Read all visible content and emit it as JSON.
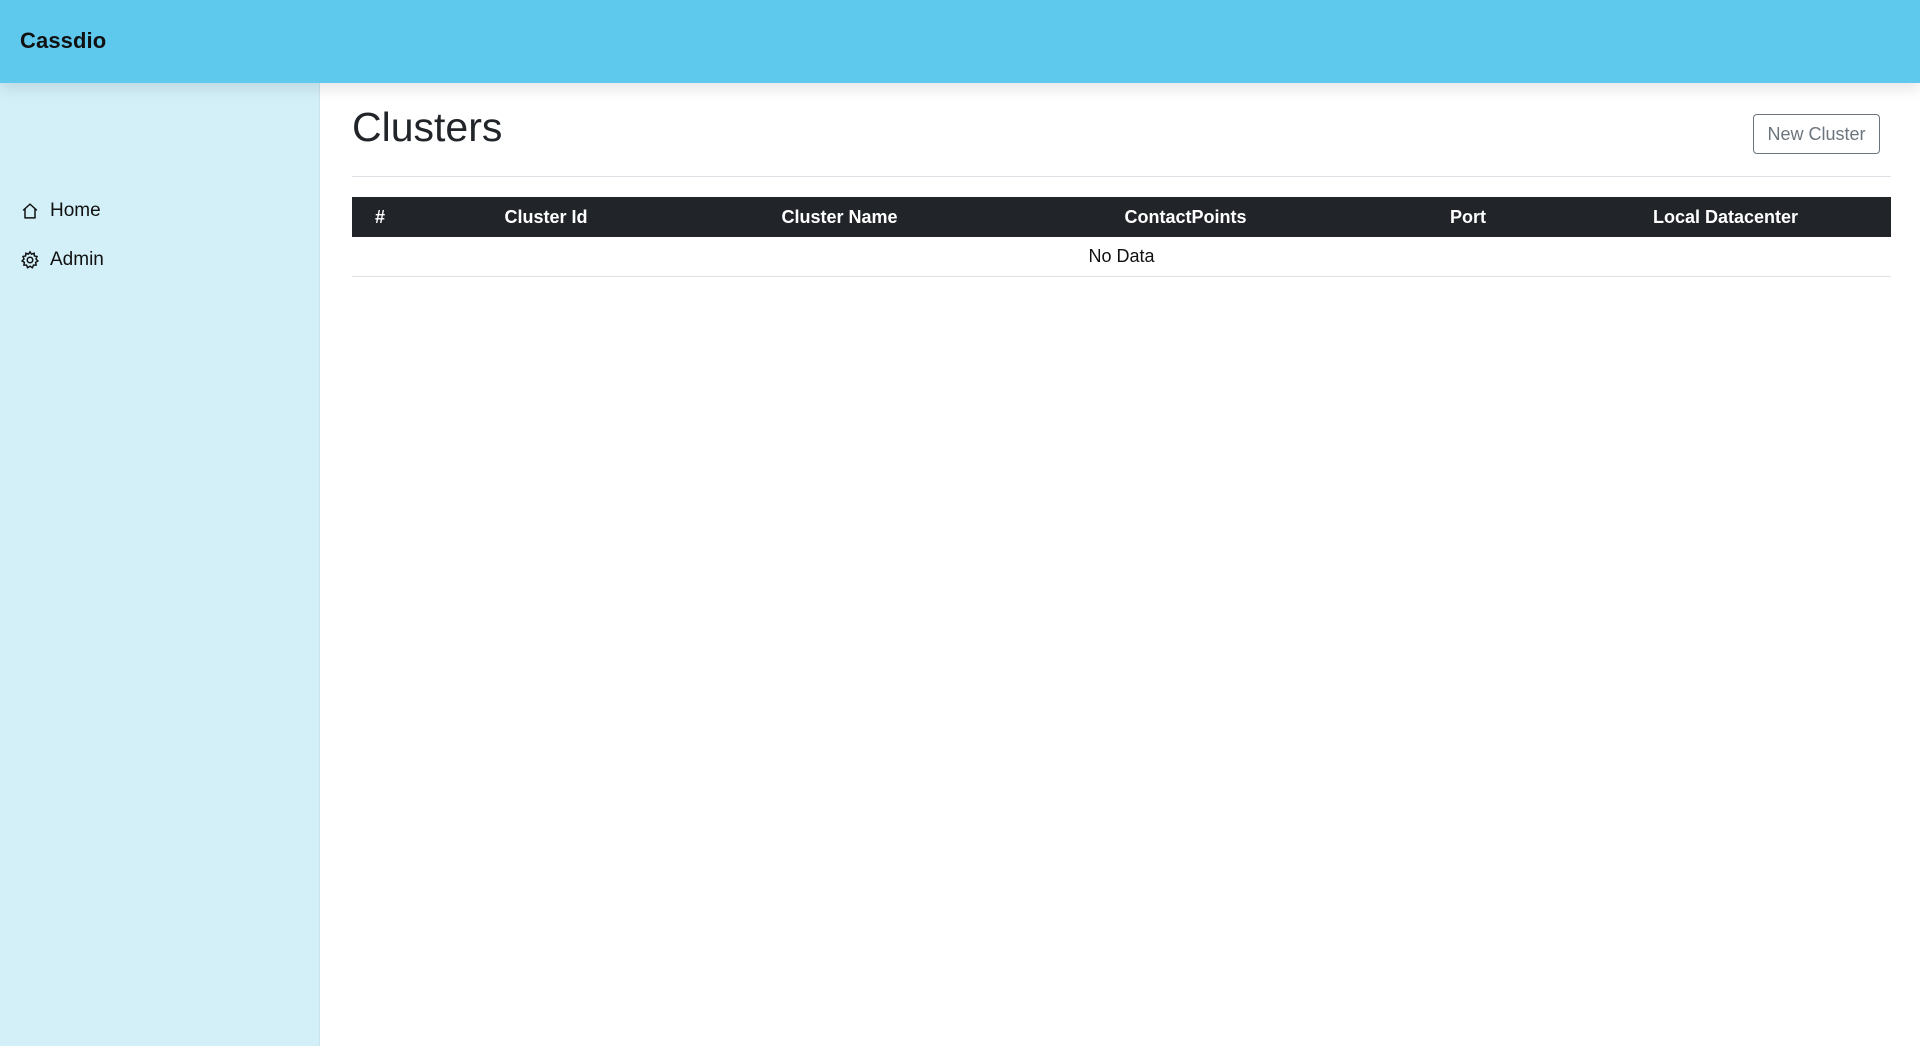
{
  "app": {
    "brand": "Cassdio"
  },
  "sidebar": {
    "items": [
      {
        "label": "Home",
        "icon": "home-icon"
      },
      {
        "label": "Admin",
        "icon": "gear-icon"
      }
    ]
  },
  "page": {
    "title": "Clusters",
    "new_button_label": "New Cluster"
  },
  "table": {
    "columns": [
      "#",
      "Cluster Id",
      "Cluster Name",
      "ContactPoints",
      "Port",
      "Local Datacenter"
    ],
    "empty_text": "No Data"
  },
  "colors": {
    "topbar": "#5fc8ed",
    "sidebar": "#d3f0f9",
    "table_header": "#212529"
  }
}
